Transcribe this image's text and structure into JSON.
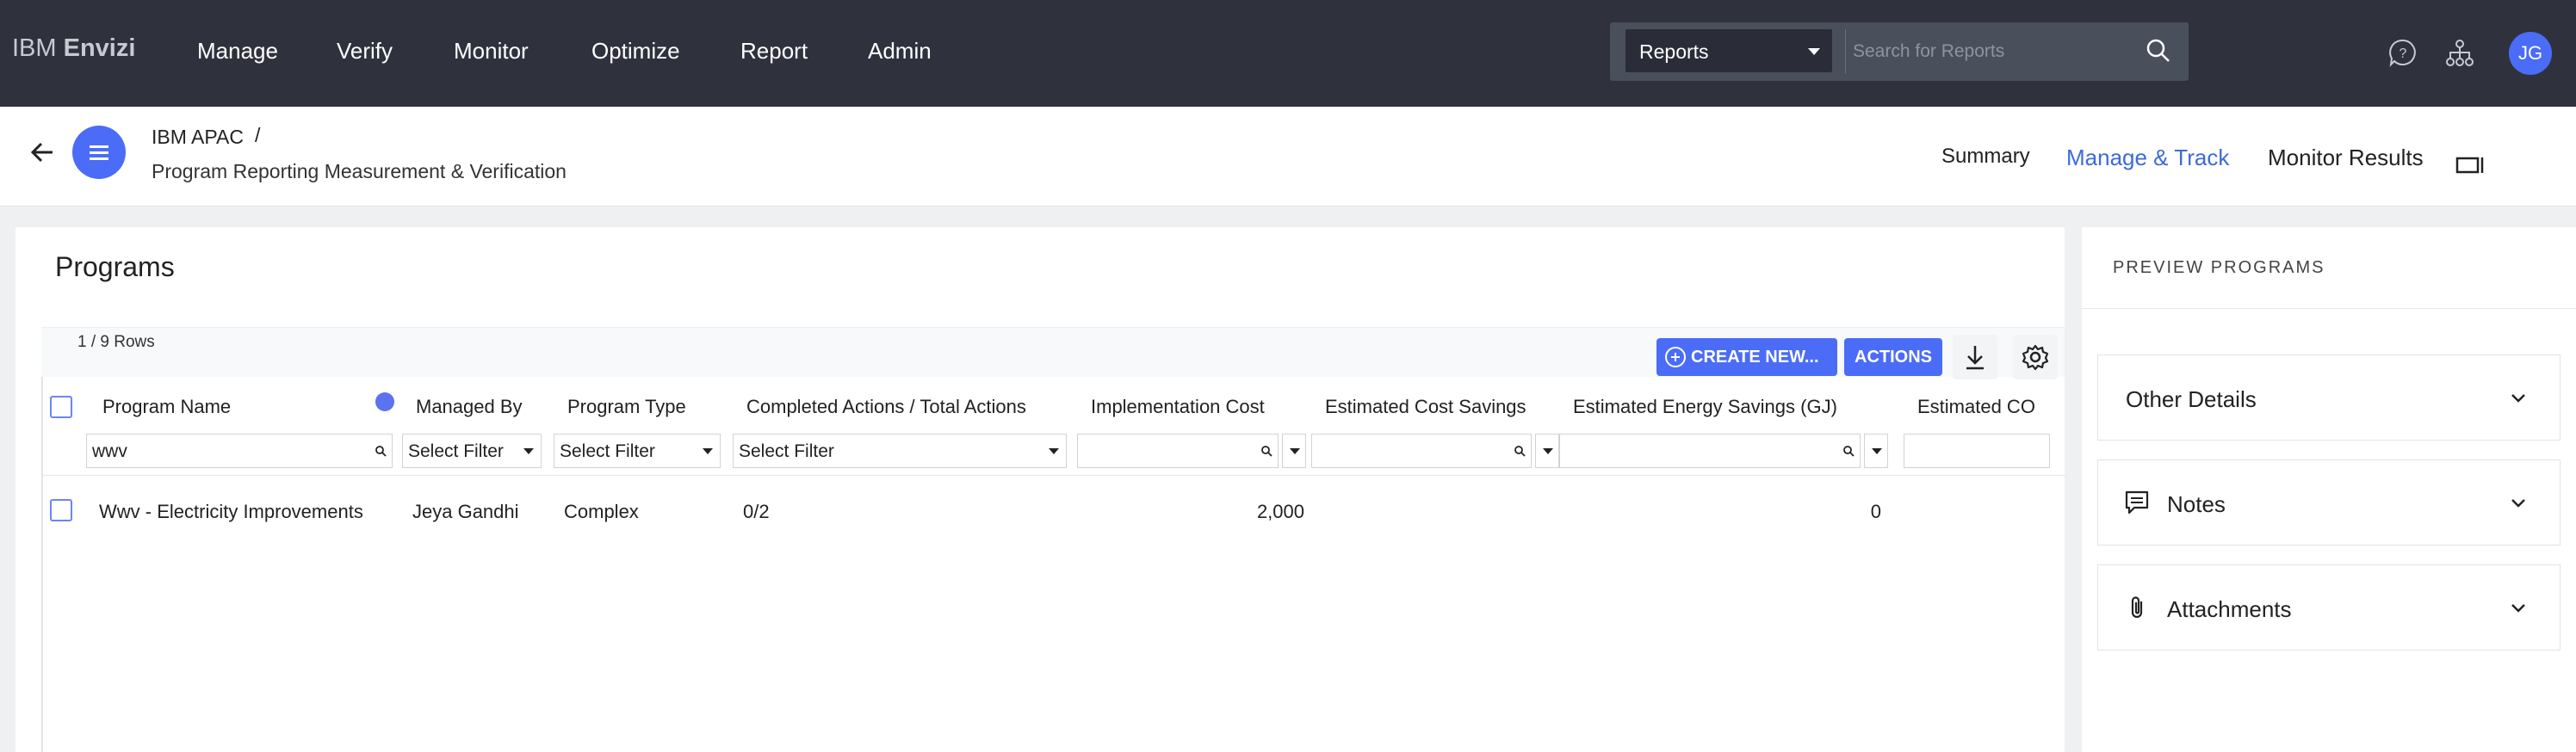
{
  "brand": {
    "prefix": "IBM",
    "name": "Envizi"
  },
  "nav": [
    "Manage",
    "Verify",
    "Monitor",
    "Optimize",
    "Report",
    "Admin"
  ],
  "search": {
    "scope": "Reports",
    "placeholder": "Search for Reports"
  },
  "user": {
    "initials": "JG"
  },
  "breadcrumb": {
    "org": "IBM APAC",
    "separator": "/",
    "page": "Program Reporting Measurement & Verification"
  },
  "tabs": [
    "Summary",
    "Manage & Track",
    "Monitor Results"
  ],
  "active_tab": "Manage & Track",
  "programs": {
    "title": "Programs",
    "rows_count": "1 / 9 Rows",
    "create_label": "CREATE NEW...",
    "actions_label": "ACTIONS",
    "columns": [
      "Program Name",
      "Managed By",
      "Program Type",
      "Completed Actions / Total Actions",
      "Implementation Cost",
      "Estimated Cost Savings",
      "Estimated Energy Savings (GJ)",
      "Estimated CO"
    ],
    "filters": {
      "name": "wwv",
      "managed_by": "Select Filter",
      "program_type": "Select Filter",
      "completed": "Select Filter"
    },
    "rows": [
      {
        "name": "Wwv - Electricity Improvements",
        "managed_by": "Jeya Gandhi",
        "type": "Complex",
        "completed": "0/2",
        "implementation_cost": "2,000",
        "cost_savings": "",
        "energy_savings": "0"
      }
    ]
  },
  "preview": {
    "title": "PREVIEW PROGRAMS",
    "sections": [
      "Other Details",
      "Notes",
      "Attachments"
    ]
  },
  "colors": {
    "accent": "#4a6cf7",
    "topbar": "#2f323d",
    "active_tab": "#3b6bd9"
  }
}
